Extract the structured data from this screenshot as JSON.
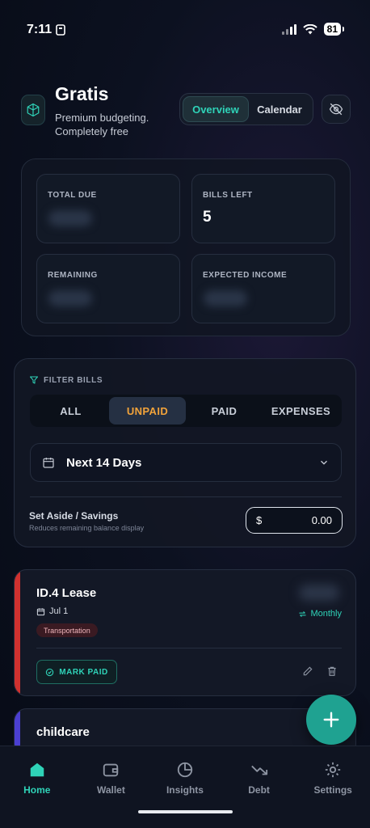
{
  "status": {
    "time": "7:11",
    "battery": "81"
  },
  "header": {
    "title": "Gratis",
    "tagline": "Premium budgeting. Completely free",
    "tabs": [
      "Overview",
      "Calendar"
    ]
  },
  "summary": {
    "total_due_label": "TOTAL DUE",
    "bills_left_label": "BILLS LEFT",
    "bills_left_value": "5",
    "remaining_label": "REMAINING",
    "expected_income_label": "EXPECTED INCOME"
  },
  "filter": {
    "title": "FILTER BILLS",
    "options": [
      "ALL",
      "UNPAID",
      "PAID",
      "EXPENSES"
    ],
    "range": "Next 14 Days",
    "savings_title": "Set Aside / Savings",
    "savings_sub": "Reduces remaining balance display",
    "currency": "$",
    "savings_value": "0.00"
  },
  "bills": [
    {
      "name": "ID.4 Lease",
      "date": "Jul 1",
      "tag": "Transportation",
      "frequency": "Monthly",
      "action": "MARK PAID",
      "color": "#d0312f"
    },
    {
      "name": "childcare",
      "color": "#4b3fd1"
    }
  ],
  "nav": [
    "Home",
    "Wallet",
    "Insights",
    "Debt",
    "Settings"
  ],
  "colors": {
    "accent": "#2fd3b8",
    "active_filter": "#f2a33a"
  }
}
